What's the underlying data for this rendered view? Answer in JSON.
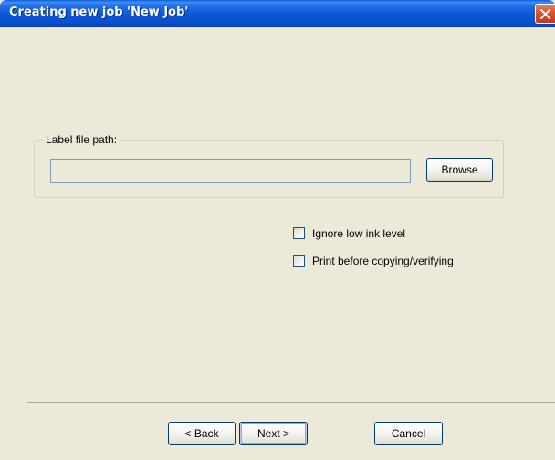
{
  "window": {
    "title": "Creating new job 'New Job'"
  },
  "label_group": {
    "legend": "Label file path:",
    "path_value": "",
    "browse_label": "Browse"
  },
  "options": [
    {
      "label": "Ignore low ink level",
      "checked": false
    },
    {
      "label": "Print before copying/verifying",
      "checked": false
    }
  ],
  "footer": {
    "back_label": "< Back",
    "next_label": "Next >",
    "cancel_label": "Cancel"
  },
  "colors": {
    "titlebar": "#0a55d6",
    "close_button": "#d6542f",
    "dialog_background": "#ece9d8",
    "button_border": "#003c74"
  },
  "icons": {
    "close": "close-icon"
  }
}
